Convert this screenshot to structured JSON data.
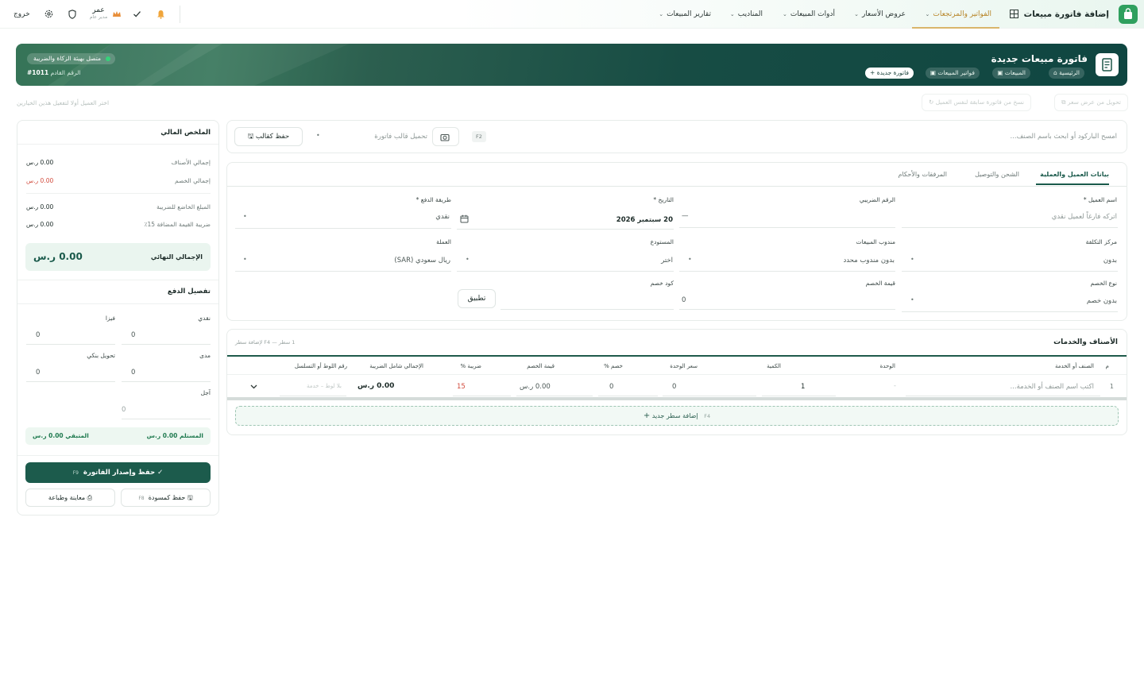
{
  "nav": {
    "title": "إضافة فاتورة مبيعات",
    "items": [
      {
        "label": "الفواتير والمرتجعات",
        "active": true
      },
      {
        "label": "عروض الأسعار"
      },
      {
        "label": "أدوات المبيعات"
      },
      {
        "label": "المناديب"
      },
      {
        "label": "تقارير المبيعات"
      }
    ],
    "user_name": "عمر",
    "user_role": "مدير عام",
    "logout": "خروج"
  },
  "hero": {
    "title": "فاتورة مبيعات جديدة",
    "breadcrumbs": [
      "الرئيسية",
      "المبيعات",
      "فواتير المبيعات",
      "فاتورة جديدة"
    ],
    "status": "متصل بهيئة الزكاة والضريبة",
    "next_number_label": "الرقم القادم",
    "next_number": "1011#"
  },
  "actions": {
    "convert_quote": "تحويل من عرض سعر",
    "copy_invoice": "نسخ من فاتورة سابقة لنفس العميل",
    "hint": "اختر العميل أولا لتفعيل هذين الخيارين"
  },
  "search": {
    "placeholder": "امسح الباركود أو ابحث باسم الصنف...",
    "shortcut": "F2",
    "template_placeholder": "تحميل قالب فاتورة",
    "save_template": "حفظ كقالب"
  },
  "tabs": [
    "بيانات العميل والعملية",
    "الشحن والتوصيل",
    "المرفقات والأحكام"
  ],
  "form": {
    "customer_label": "اسم العميل *",
    "customer_placeholder": "اتركه فارغاً لعميل نقدي",
    "tax_label": "الرقم الضريبي",
    "tax_value": "—",
    "date_label": "التاريخ *",
    "date_value": "20 سبتمبر 2026",
    "payment_label": "طريقة الدفع *",
    "payment_value": "نقدي",
    "cost_center_label": "مركز التكلفة",
    "cost_center_value": "بدون",
    "rep_label": "مندوب المبيعات",
    "rep_value": "بدون مندوب محدد",
    "warehouse_label": "المستودع",
    "warehouse_value": "اختر",
    "currency_label": "العملة",
    "currency_value": "ريال سعودي (SAR)",
    "discount_type_label": "نوع الخصم",
    "discount_type_value": "بدون خصم",
    "discount_value_label": "قيمة الخصم",
    "discount_value": "0",
    "discount_code_label": "كود خصم",
    "apply": "تطبيق"
  },
  "items": {
    "title": "الأصناف والخدمات",
    "hint": "1 سطر — F4 لإضافة سطر",
    "headers": [
      "م",
      "الصنف أو الخدمة",
      "الوحدة",
      "الكمية",
      "سعر الوحدة",
      "خصم %",
      "قيمة الخصم",
      "ضريبة %",
      "الإجمالي شامل الضريبة",
      "رقم اللوط أو التسلسل"
    ],
    "row": {
      "index": "1",
      "item_placeholder": "اكتب اسم الصنف أو الخدمة...",
      "unit": "-",
      "qty": "1",
      "price": "0",
      "discount_pct": "0",
      "discount_value": "0.00 ر.س",
      "tax_pct": "15",
      "total": "0.00 ر.س",
      "lot": "بلا لوط – خدمة"
    },
    "add_row": "إضافة سطر جديد",
    "add_row_key": "F4"
  },
  "summary": {
    "title": "الملخص المالي",
    "rows": [
      {
        "label": "إجمالي الأصناف",
        "value": "0.00 ر.س"
      },
      {
        "label": "إجمالي الخصم",
        "value": "0.00 ر.س"
      },
      {
        "label": "المبلغ الخاضع للضريبة",
        "value": "0.00 ر.س"
      },
      {
        "label": "ضريبة القيمة المضافة 15٪",
        "value": "0.00 ر.س"
      }
    ],
    "final_label": "الإجمالي النهائي",
    "final_value": "0.00 ر.س"
  },
  "payment": {
    "title": "تفصيل الدفع",
    "cash_label": "نقدي",
    "cash_value": "0",
    "visa_label": "فيزا",
    "visa_value": "0",
    "mada_label": "مدى",
    "mada_value": "0",
    "transfer_label": "تحويل بنكي",
    "transfer_value": "0",
    "credit_label": "آجل",
    "credit_value": "0",
    "received_label": "المستلم",
    "received_value": "0.00 ر.س",
    "remaining_label": "المتبقي",
    "remaining_value": "0.00 ر.س"
  },
  "buttons": {
    "save_issue": "حفظ وإصدار الفاتورة",
    "save_issue_key": "F9",
    "save_draft": "حفظ كمسودة",
    "save_draft_key": "F8",
    "preview_print": "معاينة وطباعة"
  }
}
